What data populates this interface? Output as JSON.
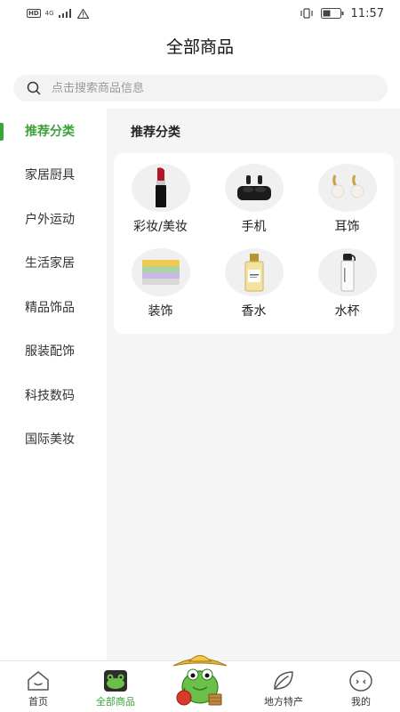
{
  "status": {
    "hd": "HD",
    "network": "4G",
    "time": "11:57"
  },
  "header": {
    "title": "全部商品"
  },
  "search": {
    "placeholder": "点击搜索商品信息",
    "icon": "search-icon"
  },
  "sidebar": {
    "items": [
      {
        "label": "推荐分类",
        "active": true
      },
      {
        "label": "家居厨具",
        "active": false
      },
      {
        "label": "户外运动",
        "active": false
      },
      {
        "label": "生活家居",
        "active": false
      },
      {
        "label": "精品饰品",
        "active": false
      },
      {
        "label": "服装配饰",
        "active": false
      },
      {
        "label": "科技数码",
        "active": false
      },
      {
        "label": "国际美妆",
        "active": false
      }
    ]
  },
  "main": {
    "section_title": "推荐分类",
    "categories": [
      {
        "label": "彩妆/美妆",
        "icon": "lipstick-icon"
      },
      {
        "label": "手机",
        "icon": "earbuds-icon"
      },
      {
        "label": "耳饰",
        "icon": "earrings-icon"
      },
      {
        "label": "装饰",
        "icon": "towels-icon"
      },
      {
        "label": "香水",
        "icon": "perfume-icon"
      },
      {
        "label": "水杯",
        "icon": "water-bottle-icon"
      }
    ]
  },
  "tabbar": {
    "tabs": [
      {
        "label": "首页",
        "icon": "home-icon",
        "active": false
      },
      {
        "label": "全部商品",
        "icon": "frog-icon",
        "active": true
      },
      {
        "label": "",
        "icon": "mascot-icon",
        "active": false
      },
      {
        "label": "地方特产",
        "icon": "leaf-icon",
        "active": false
      },
      {
        "label": "我的",
        "icon": "face-icon",
        "active": false
      }
    ]
  },
  "colors": {
    "accent": "#3aa33a",
    "background": "#f5f5f5"
  }
}
